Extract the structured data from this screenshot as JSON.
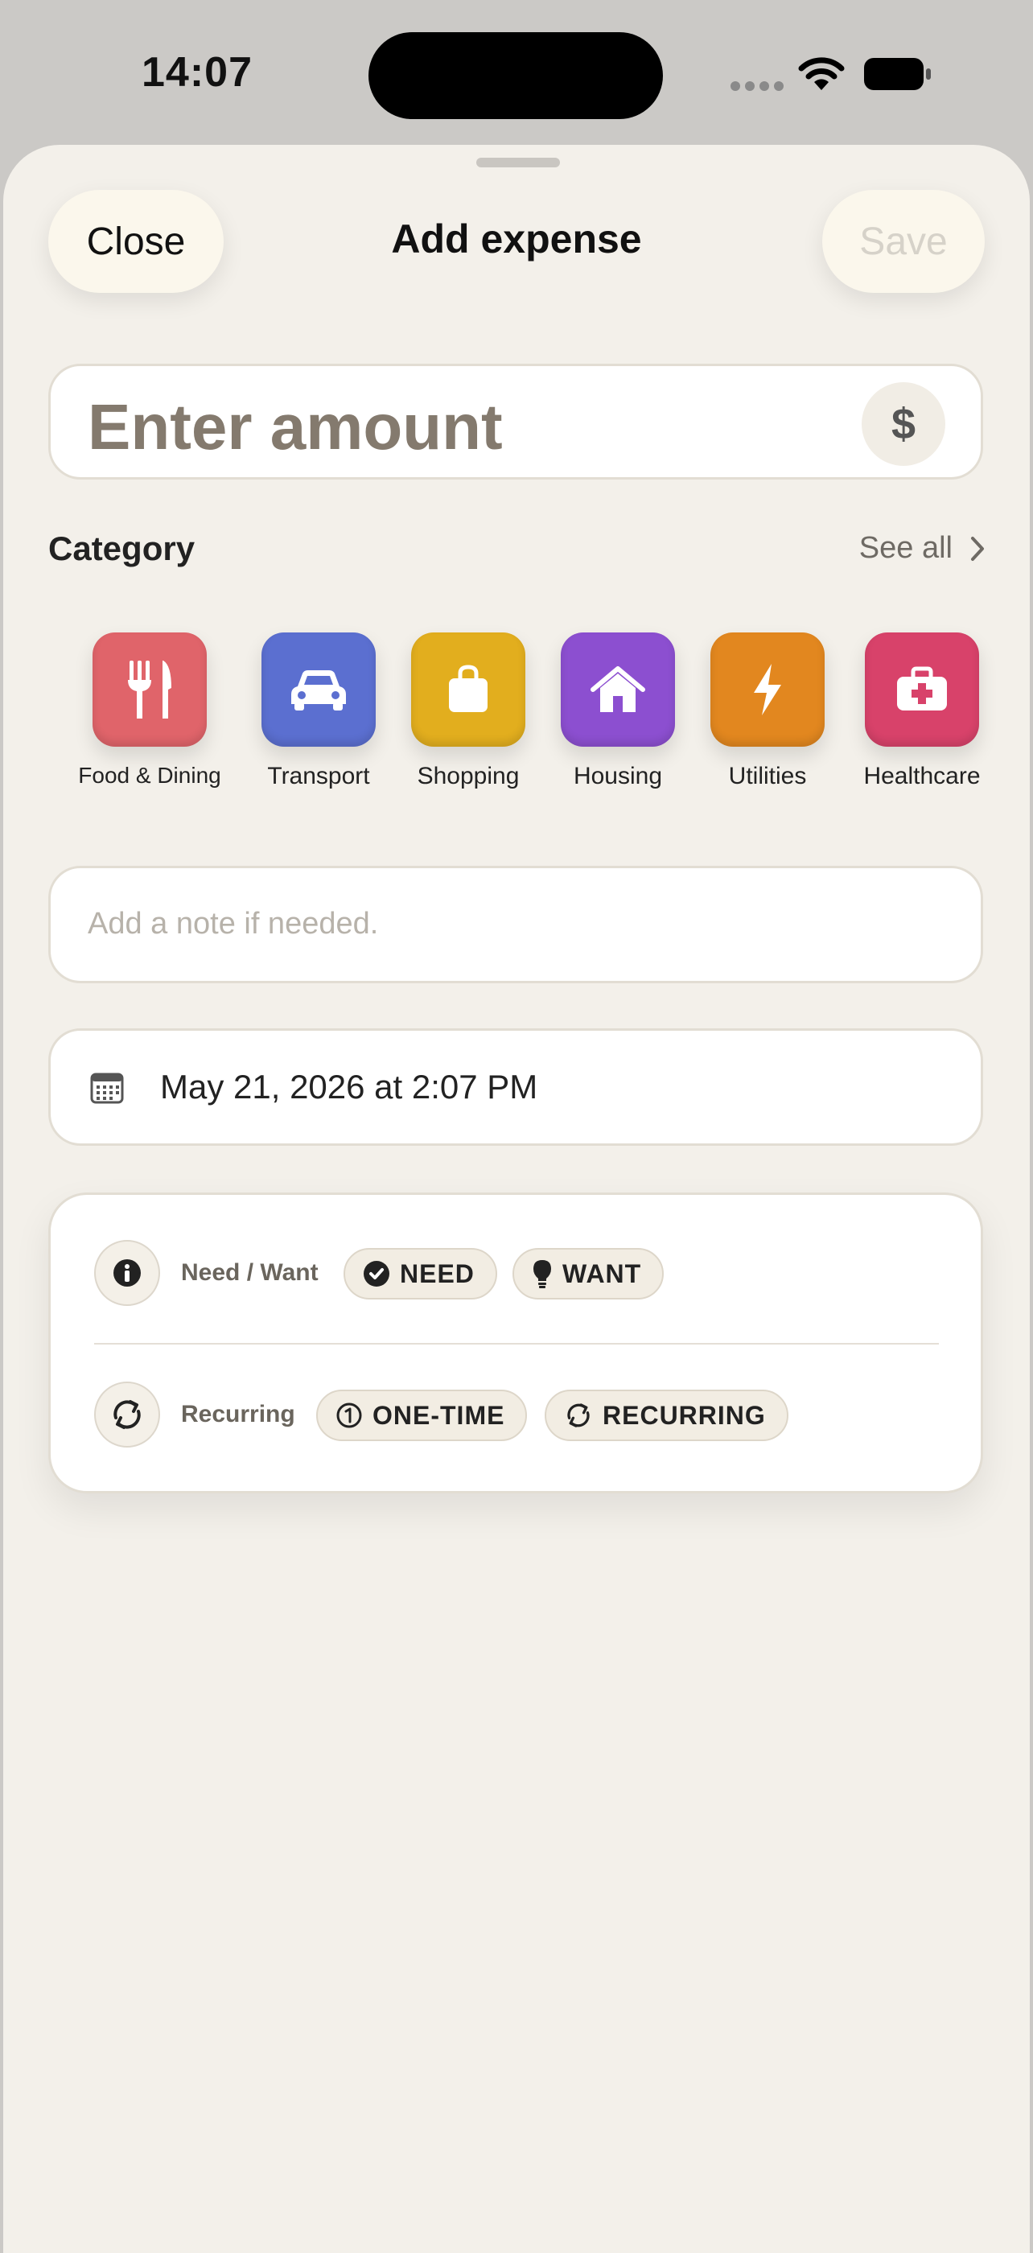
{
  "status_bar": {
    "time": "14:07"
  },
  "header": {
    "close_label": "Close",
    "title": "Add expense",
    "save_label": "Save"
  },
  "amount": {
    "placeholder": "Enter amount",
    "currency_symbol": "$"
  },
  "category": {
    "label": "Category",
    "see_all_label": "See all",
    "items": [
      {
        "label": "Food & Dining",
        "icon": "fork-knife-icon",
        "color": "#e0646a"
      },
      {
        "label": "Transport",
        "icon": "car-icon",
        "color": "#5b6fd0"
      },
      {
        "label": "Shopping",
        "icon": "shopping-bag-icon",
        "color": "#e2ae1e"
      },
      {
        "label": "Housing",
        "icon": "house-icon",
        "color": "#8c4fd0"
      },
      {
        "label": "Utilities",
        "icon": "bolt-icon",
        "color": "#e2871f"
      },
      {
        "label": "Healthcare",
        "icon": "medical-kit-icon",
        "color": "#d8426a"
      }
    ]
  },
  "note": {
    "placeholder": "Add a note if needed."
  },
  "date": {
    "value": "May 21, 2026 at 2:07 PM"
  },
  "options": {
    "need_want": {
      "label": "Need / Want",
      "need_label": "NEED",
      "want_label": "WANT"
    },
    "recurring": {
      "label": "Recurring",
      "one_time_label": "ONE-TIME",
      "recurring_label": "RECURRING"
    }
  }
}
